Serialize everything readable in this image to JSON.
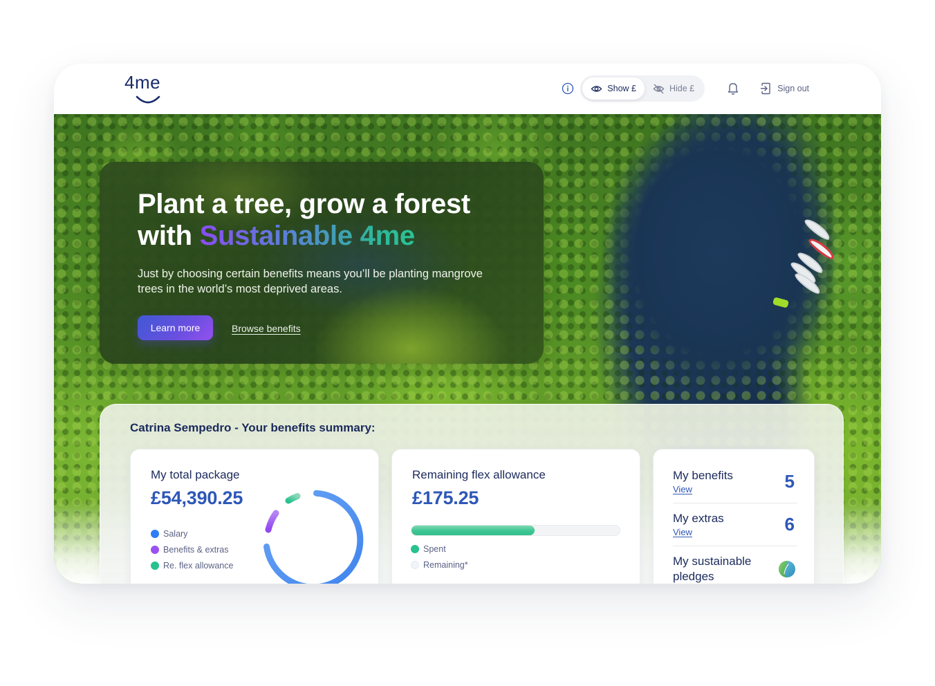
{
  "header": {
    "logo_text": "4me",
    "info_icon": "info-icon",
    "toggle": [
      {
        "label": "Show £",
        "icon": "eye-icon",
        "active": true
      },
      {
        "label": "Hide £",
        "icon": "eye-off-icon",
        "active": false
      }
    ],
    "notifications_icon": "bell-icon",
    "sign_out_label": "Sign out",
    "sign_out_icon": "sign-out-icon"
  },
  "hero": {
    "title_line1": "Plant a tree, grow a forest",
    "title_line2_prefix": "with ",
    "title_highlight": "Sustainable 4me",
    "subtitle": "Just by choosing certain benefits means you’ll be planting mangrove trees in the world’s most deprived areas.",
    "primary_button": "Learn more",
    "secondary_link": "Browse benefits"
  },
  "summary": {
    "title": "Catrina Sempedro - Your benefits summary:",
    "total_package": {
      "label": "My total package",
      "amount": "£54,390.25",
      "legend": [
        {
          "label": "Salary",
          "color": "#2f7cf6"
        },
        {
          "label": "Benefits & extras",
          "color": "#9b51f0"
        },
        {
          "label": "Re. flex allowance",
          "color": "#27c28d"
        }
      ]
    },
    "flex_allowance": {
      "label": "Remaining flex allowance",
      "amount": "£175.25",
      "spent_fraction": 0.59,
      "legend": [
        {
          "label": "Spent",
          "color": "#27c28d"
        },
        {
          "label": "Remaining*",
          "color": "#eef1f6"
        }
      ]
    },
    "stats": [
      {
        "label": "My benefits",
        "link": "View",
        "count": "5"
      },
      {
        "label": "My extras",
        "link": "View",
        "count": "6"
      },
      {
        "label": "My sustainable pledges",
        "icon": "sustainable-leaf-drop-icon"
      }
    ]
  },
  "colors": {
    "brand_navy": "#172a6b",
    "accent_blue": "#2e57b8",
    "button_gradient_start": "#3f59d4",
    "button_gradient_end": "#9550ef",
    "highlight_gradient_start": "#8a4df0",
    "highlight_gradient_end": "#29c495"
  }
}
